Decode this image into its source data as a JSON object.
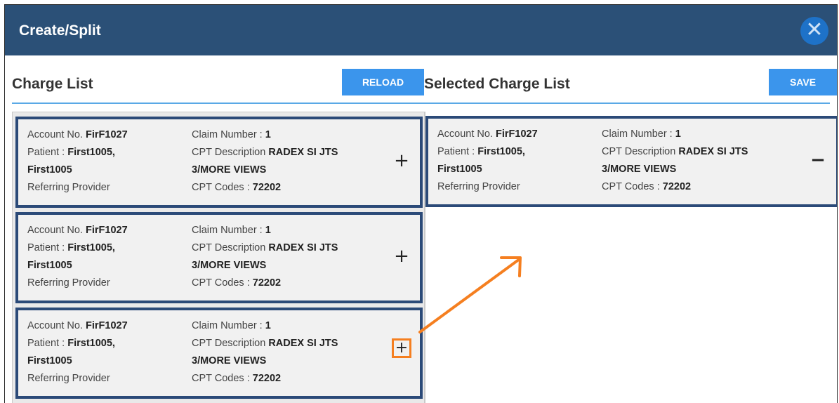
{
  "dialog": {
    "title": "Create/Split",
    "close_icon": "close-icon"
  },
  "charge_list": {
    "title": "Charge List",
    "reload_label": "RELOAD",
    "cards": [
      {
        "account_label": "Account No.",
        "account_value": "FirF1027",
        "patient_label": "Patient :",
        "patient_value": "First1005,",
        "patient_value2": "First1005",
        "referring_label": "Referring Provider",
        "claim_label": "Claim Number :",
        "claim_value": "1",
        "cpt_desc_label": "CPT Description",
        "cpt_desc_value": "RADEX SI JTS",
        "cpt_desc_value2": "3/MORE VIEWS",
        "cpt_codes_label": "CPT Codes :",
        "cpt_codes_value": "72202",
        "action": "+"
      },
      {
        "account_label": "Account No.",
        "account_value": "FirF1027",
        "patient_label": "Patient :",
        "patient_value": "First1005,",
        "patient_value2": "First1005",
        "referring_label": "Referring Provider",
        "claim_label": "Claim Number :",
        "claim_value": "1",
        "cpt_desc_label": "CPT Description",
        "cpt_desc_value": "RADEX SI JTS",
        "cpt_desc_value2": "3/MORE VIEWS",
        "cpt_codes_label": "CPT Codes :",
        "cpt_codes_value": "72202",
        "action": "+"
      },
      {
        "account_label": "Account No.",
        "account_value": "FirF1027",
        "patient_label": "Patient :",
        "patient_value": "First1005,",
        "patient_value2": "First1005",
        "referring_label": "Referring Provider",
        "claim_label": "Claim Number :",
        "claim_value": "1",
        "cpt_desc_label": "CPT Description",
        "cpt_desc_value": "RADEX SI JTS",
        "cpt_desc_value2": "3/MORE VIEWS",
        "cpt_codes_label": "CPT Codes :",
        "cpt_codes_value": "72202",
        "action": "+"
      }
    ]
  },
  "selected_list": {
    "title": "Selected Charge List",
    "save_label": "SAVE",
    "cards": [
      {
        "account_label": "Account No.",
        "account_value": "FirF1027",
        "patient_label": "Patient :",
        "patient_value": "First1005,",
        "patient_value2": "First1005",
        "referring_label": "Referring Provider",
        "claim_label": "Claim Number :",
        "claim_value": "1",
        "cpt_desc_label": "CPT Description",
        "cpt_desc_value": "RADEX SI JTS",
        "cpt_desc_value2": "3/MORE VIEWS",
        "cpt_codes_label": "CPT Codes :",
        "cpt_codes_value": "72202",
        "action": "−"
      }
    ]
  },
  "colors": {
    "header": "#2b5077",
    "button": "#3b95ec",
    "card_border": "#2b4a78",
    "highlight": "#f57f20"
  }
}
